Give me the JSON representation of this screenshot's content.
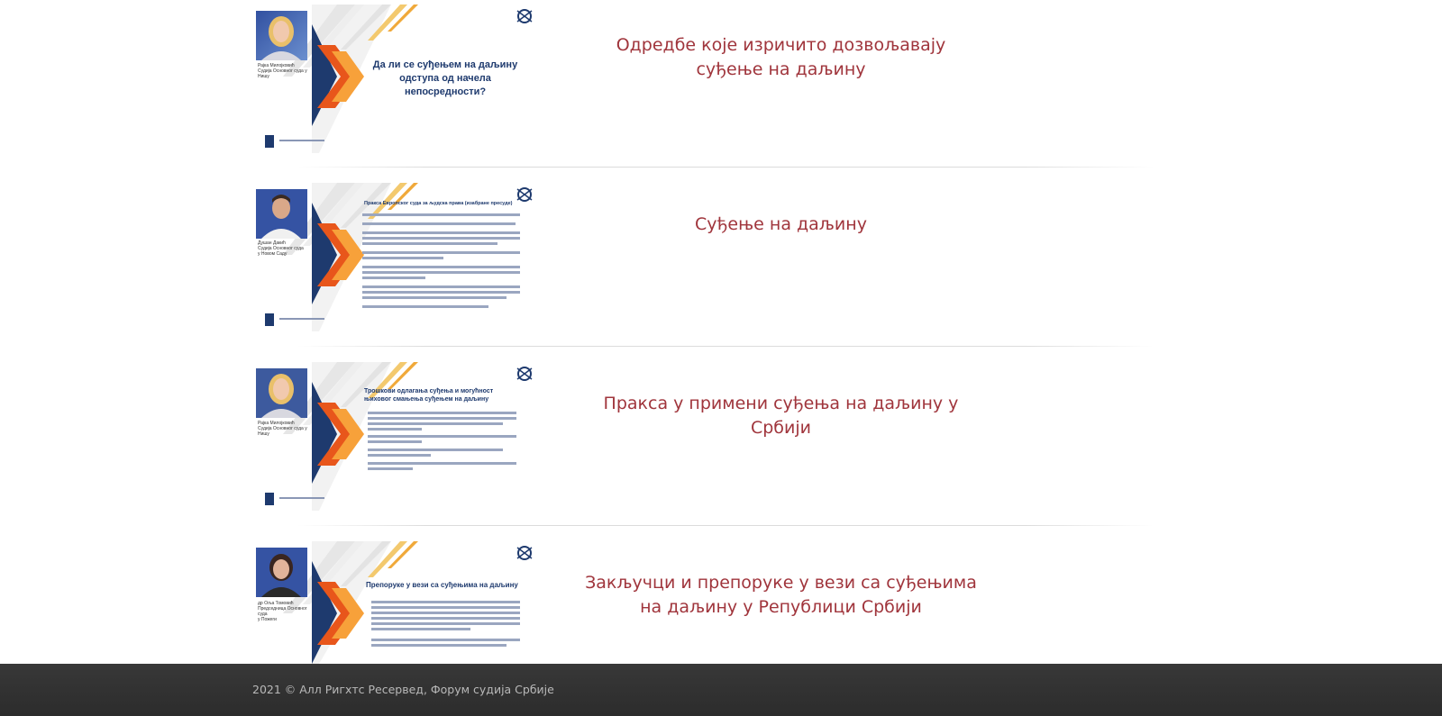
{
  "videos": [
    {
      "title": "Одредбе које изричито дозвољавају суђење на даљину",
      "slide_heading": [
        "Да ли се суђењем на даљину",
        "одступа од начела",
        "непосредности?"
      ],
      "speaker_caption": [
        "Рајка Милојковић",
        "Судија Основног суда у Нишу"
      ]
    },
    {
      "title": "Суђење на даљину",
      "slide_heading": [
        "Пракса Европског суда за људска права (изабране пресуде)"
      ],
      "speaker_caption": [
        "Душан Дакић",
        "Судија Основног суда",
        "у Новом Саду"
      ]
    },
    {
      "title": "Пракса у примени суђења на даљину у Србији",
      "slide_heading": [
        "Трошкови одлагања суђења и могућност",
        "њиховог смањења суђењем на даљину"
      ],
      "speaker_caption": [
        "Рајка Милојковић",
        "Судија Основног суда у Нишу"
      ]
    },
    {
      "title": "Закључци и препоруке у вези са суђењима на даљину у Републици Србији",
      "slide_heading": [
        "Препоруке у вези са суђењима на даљину"
      ],
      "speaker_caption": [
        "др Оља Томовић",
        "Председница Основног суда",
        "у Пожеги"
      ]
    }
  ],
  "footer": {
    "copyright": "2021 © Алл Ригхтс Ресервед, Форум судија Србије"
  },
  "colors": {
    "title": "#a0353c",
    "slide_navy": "#1e3a6e",
    "slide_orange": "#f07e26",
    "footer_bg": "#333333",
    "footer_text": "#b9b9b9"
  }
}
